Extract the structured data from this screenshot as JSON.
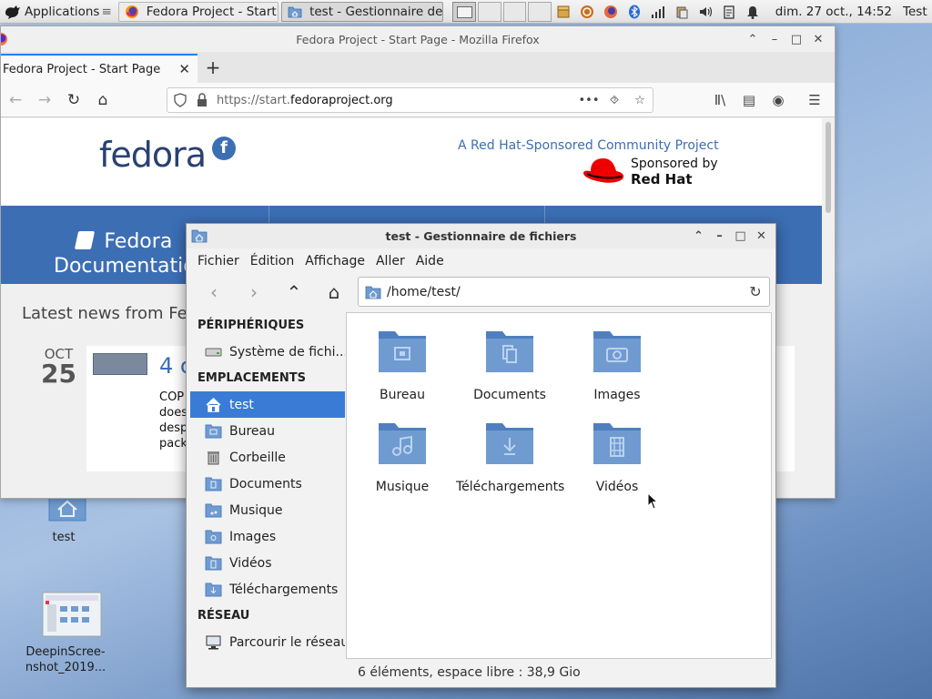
{
  "panel": {
    "apps_label": "Applications",
    "apps_sep": "≡",
    "tasks": [
      {
        "label": "Fedora Project - Start P..."
      },
      {
        "label": "test - Gestionnaire de ..."
      }
    ],
    "clock": "dim. 27 oct., 14:52",
    "user": "Test"
  },
  "desktop": {
    "icons": [
      {
        "label": "test"
      },
      {
        "label": "DeepinScree-\nnshot_2019..."
      }
    ]
  },
  "firefox": {
    "window_title": "Fedora Project - Start Page - Mozilla Firefox",
    "tab_label": "Fedora Project - Start Page",
    "url_scheme": "https://start.",
    "url_domain": "fedoraproject.org",
    "page": {
      "logo_text": "fedora",
      "tagline": "A Red Hat-Sponsored Community Project",
      "sponsor_line1": "Sponsored by",
      "sponsor_line2": "Red Hat",
      "doc_line1": "Fedora",
      "doc_line2": "Documentatio",
      "news_title": "Latest news from Fed",
      "news_month": "OCT",
      "news_day": "25",
      "news_heading": "4 c",
      "news_excerpt": [
        "COP",
        "does",
        "desp",
        "pack"
      ]
    }
  },
  "file_manager": {
    "window_title": "test - Gestionnaire de fichiers",
    "menu": [
      "Fichier",
      "Édition",
      "Affichage",
      "Aller",
      "Aide"
    ],
    "location": "/home/test/",
    "sidebar": {
      "sections": [
        {
          "header": "PÉRIPHÉRIQUES",
          "items": [
            {
              "label": "Système de fichi...",
              "icon": "drive-icon"
            }
          ]
        },
        {
          "header": "EMPLACEMENTS",
          "items": [
            {
              "label": "test",
              "icon": "home-icon",
              "selected": true
            },
            {
              "label": "Bureau",
              "icon": "folder-desktop-icon"
            },
            {
              "label": "Corbeille",
              "icon": "trash-icon"
            },
            {
              "label": "Documents",
              "icon": "folder-documents-icon"
            },
            {
              "label": "Musique",
              "icon": "folder-music-icon"
            },
            {
              "label": "Images",
              "icon": "folder-pictures-icon"
            },
            {
              "label": "Vidéos",
              "icon": "folder-videos-icon"
            },
            {
              "label": "Téléchargements",
              "icon": "folder-downloads-icon"
            }
          ]
        },
        {
          "header": "RÉSEAU",
          "items": [
            {
              "label": "Parcourir le réseau",
              "icon": "network-icon"
            }
          ]
        }
      ]
    },
    "items": [
      {
        "label": "Bureau",
        "icon": "folder-desktop-icon"
      },
      {
        "label": "Documents",
        "icon": "folder-documents-icon"
      },
      {
        "label": "Images",
        "icon": "folder-pictures-icon"
      },
      {
        "label": "Musique",
        "icon": "folder-music-icon"
      },
      {
        "label": "Téléchargements",
        "icon": "folder-downloads-icon"
      },
      {
        "label": "Vidéos",
        "icon": "folder-videos-icon"
      }
    ],
    "status": "6 éléments, espace libre : 38,9 Gio"
  },
  "colors": {
    "folder": "#6f9bd1",
    "folder_dark": "#4f7fbf",
    "selection": "#3a7bd5",
    "fedora_blue": "#3c6eb4"
  }
}
